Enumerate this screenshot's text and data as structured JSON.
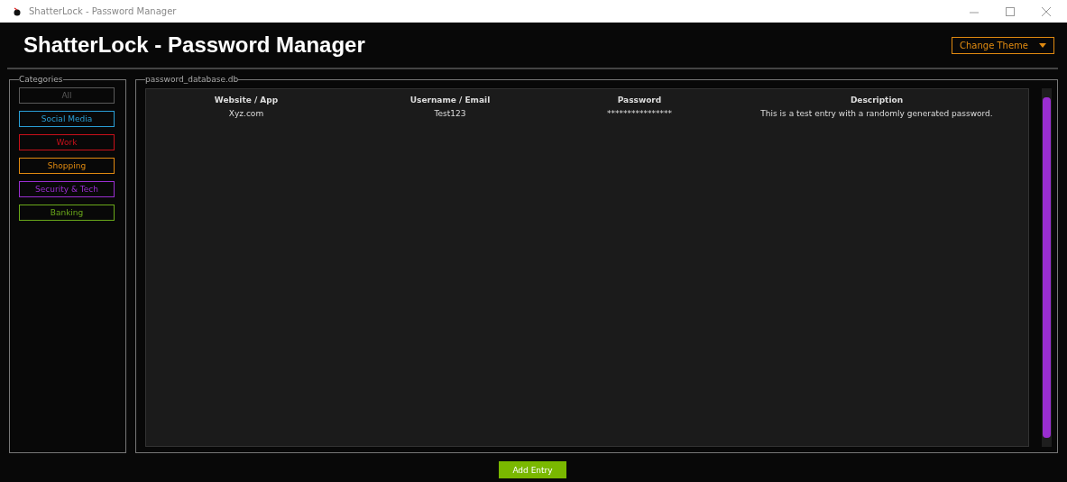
{
  "window": {
    "title": "ShatterLock - Password Manager"
  },
  "header": {
    "title": "ShatterLock - Password Manager",
    "theme_button": "Change Theme"
  },
  "categories": {
    "title": "Categories",
    "items": [
      {
        "label": "All",
        "color": "#5a5a5a"
      },
      {
        "label": "Social Media",
        "color": "#2a9fd6"
      },
      {
        "label": "Work",
        "color": "#c8101a"
      },
      {
        "label": "Shopping",
        "color": "#e08a10"
      },
      {
        "label": "Security & Tech",
        "color": "#9a2ed0"
      },
      {
        "label": "Banking",
        "color": "#6aa81a"
      }
    ]
  },
  "table": {
    "title": "password_database.db",
    "columns": [
      "Website / App",
      "Username / Email",
      "Password",
      "Description"
    ],
    "rows": [
      [
        "Xyz.com",
        "Test123",
        "****************",
        "This is a test entry with a randomly generated password."
      ]
    ]
  },
  "add_button": "Add Entry"
}
